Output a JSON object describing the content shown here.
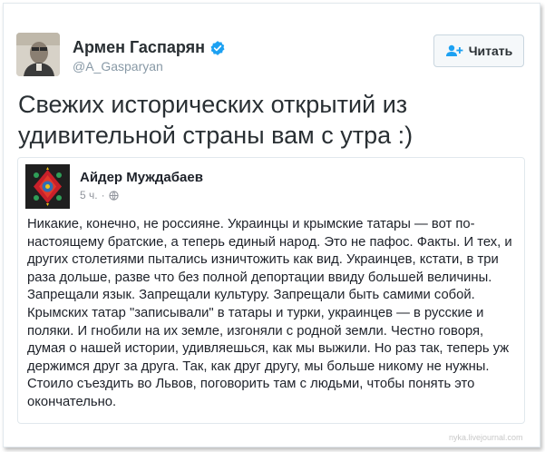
{
  "tweet": {
    "author_name": "Армен Гаспарян",
    "author_handle": "@A_Gasparyan",
    "follow_label": "Читать",
    "text": "Свежих исторических открытий из удивительной страны вам с утра :)"
  },
  "quoted_post": {
    "author_name": "Айдер Муждабаев",
    "time": "5 ч.",
    "separator": "·",
    "text": "Никакие, конечно, не россияне. Украинцы и крымские татары — вот по-настоящему братские, а теперь единый народ. Это не пафос. Факты. И тех, и других столетиями пытались изничтожить как вид. Украинцев, кстати, в три раза дольше, разве что без полной депортации ввиду большей величины. Запрещали язык. Запрещали культуру. Запрещали быть самими собой. Крымских татар \"записывали\" в татары и турки, украинцев — в русские и поляки. И гнобили на их земле, изгоняли с родной земли. Честно говоря, думая о нашей истории, удивляешься, как мы выжили. Но раз так, теперь уж держимся друг за друга. Так, как друг другу, мы больше никому не нужны. Стоило съездить во Львов, поговорить там с людьми, чтобы понять это окончательно."
  },
  "watermark": "nyka.livejournal.com",
  "icons": {
    "verified": "verified-badge-icon",
    "follow": "follow-user-icon",
    "privacy": "globe-icon"
  },
  "colors": {
    "verified_blue": "#1da1f2",
    "follow_icon_blue": "#1da1f2",
    "meta_gray": "#90949c"
  }
}
